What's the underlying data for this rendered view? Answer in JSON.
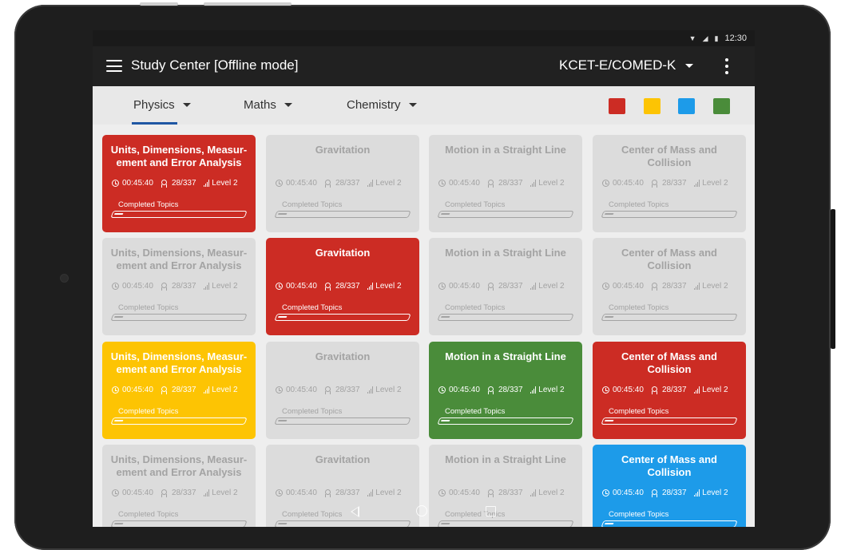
{
  "status_bar": {
    "time": "12:30",
    "icons": [
      "wifi-icon",
      "signal-icon",
      "battery-icon"
    ]
  },
  "app_bar": {
    "title": "Study Center [Offline mode]",
    "exam": "KCET-E/COMED-K"
  },
  "tabs": [
    {
      "label": "Physics",
      "active": true
    },
    {
      "label": "Maths",
      "active": false
    },
    {
      "label": "Chemistry",
      "active": false
    }
  ],
  "color_filters": [
    "#cc2c24",
    "#fdc403",
    "#1d9be9",
    "#4a8c3a"
  ],
  "cards": [
    {
      "title": "Units, Dimensions, Measur-ement  and Error Analysis",
      "time": "00:45:40",
      "score": "28/337",
      "level": "Level 2",
      "progress_label": "Completed Topics",
      "progress": 0.07,
      "color": "red"
    },
    {
      "title": "Gravitation",
      "time": "00:45:40",
      "score": "28/337",
      "level": "Level 2",
      "progress_label": "Completed Topics",
      "progress": 0.07,
      "color": "grey"
    },
    {
      "title": "Motion in a Straight Line",
      "time": "00:45:40",
      "score": "28/337",
      "level": "Level 2",
      "progress_label": "Completed Topics",
      "progress": 0.07,
      "color": "grey"
    },
    {
      "title": "Center of Mass and Collision",
      "time": "00:45:40",
      "score": "28/337",
      "level": "Level 2",
      "progress_label": "Completed Topics",
      "progress": 0.07,
      "color": "grey"
    },
    {
      "title": "Units, Dimensions, Measur-ement  and Error Analysis",
      "time": "00:45:40",
      "score": "28/337",
      "level": "Level 2",
      "progress_label": "Completed Topics",
      "progress": 0.07,
      "color": "grey"
    },
    {
      "title": "Gravitation",
      "time": "00:45:40",
      "score": "28/337",
      "level": "Level 2",
      "progress_label": "Completed Topics",
      "progress": 0.07,
      "color": "red"
    },
    {
      "title": "Motion in a Straight Line",
      "time": "00:45:40",
      "score": "28/337",
      "level": "Level 2",
      "progress_label": "Completed Topics",
      "progress": 0.07,
      "color": "grey"
    },
    {
      "title": "Center of Mass and Collision",
      "time": "00:45:40",
      "score": "28/337",
      "level": "Level 2",
      "progress_label": "Completed Topics",
      "progress": 0.07,
      "color": "grey"
    },
    {
      "title": "Units, Dimensions, Measur-ement  and Error Analysis",
      "time": "00:45:40",
      "score": "28/337",
      "level": "Level 2",
      "progress_label": "Completed Topics",
      "progress": 0.07,
      "color": "yellow"
    },
    {
      "title": "Gravitation",
      "time": "00:45:40",
      "score": "28/337",
      "level": "Level 2",
      "progress_label": "Completed Topics",
      "progress": 0.07,
      "color": "grey"
    },
    {
      "title": "Motion in a Straight Line",
      "time": "00:45:40",
      "score": "28/337",
      "level": "Level 2",
      "progress_label": "Completed Topics",
      "progress": 0.07,
      "color": "green"
    },
    {
      "title": "Center of Mass and Collision",
      "time": "00:45:40",
      "score": "28/337",
      "level": "Level 2",
      "progress_label": "Completed Topics",
      "progress": 0.07,
      "color": "red"
    },
    {
      "title": "Units, Dimensions, Measur-ement  and Error Analysis",
      "time": "00:45:40",
      "score": "28/337",
      "level": "Level 2",
      "progress_label": "Completed Topics",
      "progress": 0.07,
      "color": "grey"
    },
    {
      "title": "Gravitation",
      "time": "00:45:40",
      "score": "28/337",
      "level": "Level 2",
      "progress_label": "Completed Topics",
      "progress": 0.07,
      "color": "grey"
    },
    {
      "title": "Motion in a Straight Line",
      "time": "00:45:40",
      "score": "28/337",
      "level": "Level 2",
      "progress_label": "Completed Topics",
      "progress": 0.07,
      "color": "grey"
    },
    {
      "title": "Center of Mass and Collision",
      "time": "00:45:40",
      "score": "28/337",
      "level": "Level 2",
      "progress_label": "Completed Topics",
      "progress": 0.07,
      "color": "blue"
    }
  ],
  "nav_bar": {
    "icons": [
      "back-icon",
      "home-icon",
      "recents-icon"
    ]
  }
}
